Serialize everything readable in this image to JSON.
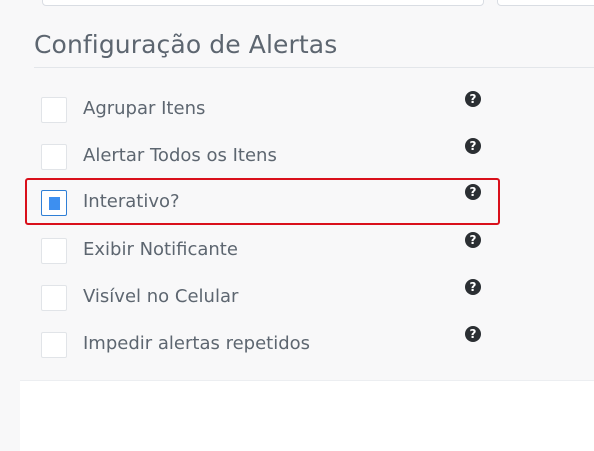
{
  "section": {
    "title": "Configuração de Alertas"
  },
  "options": [
    {
      "label": "Agrupar Itens",
      "checked": false,
      "help_icon": "question-circle-icon"
    },
    {
      "label": "Alertar Todos os Itens",
      "checked": false,
      "help_icon": "question-circle-icon"
    },
    {
      "label": "Interativo?",
      "checked": true,
      "help_icon": "question-circle-icon"
    },
    {
      "label": "Exibir Notificante",
      "checked": false,
      "help_icon": "question-circle-icon"
    },
    {
      "label": "Visível no Celular",
      "checked": false,
      "help_icon": "question-circle-icon"
    },
    {
      "label": "Impedir alertas repetidos",
      "checked": false,
      "help_icon": "question-circle-icon"
    }
  ],
  "colors": {
    "highlight": "#d9101b",
    "checked_fill": "#3d8ff0",
    "text": "#5d6670"
  }
}
